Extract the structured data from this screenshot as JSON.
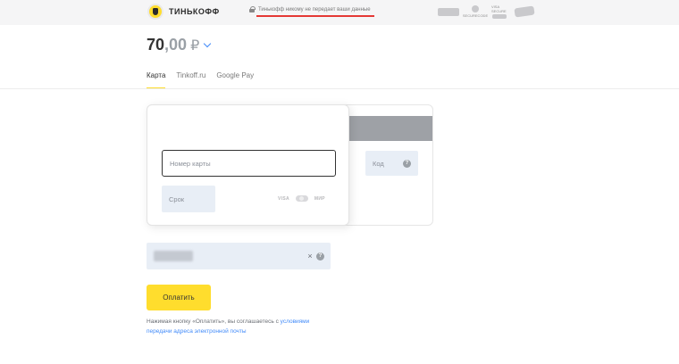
{
  "header": {
    "brand": "ТИНЬКОФФ",
    "security_note": "Тинькофф никому не передает ваши данные",
    "security_logos": [
      {
        "name": "pci-dss",
        "text": ""
      },
      {
        "name": "mastercard-securecode",
        "text": "SECURECODE"
      },
      {
        "name": "verified-by-visa",
        "text": "VISA SECURE"
      },
      {
        "name": "mir-accept",
        "text": "МИР"
      }
    ]
  },
  "amount": {
    "integer": "70",
    "fraction": ",00",
    "currency": "₽"
  },
  "tabs": [
    {
      "label": "Карта",
      "active": true
    },
    {
      "label": "Tinkoff.ru",
      "active": false
    },
    {
      "label": "Google Pay",
      "active": false
    }
  ],
  "card_form": {
    "number_placeholder": "Номер карты",
    "expiry_placeholder": "Срок",
    "cvc_label": "Код",
    "help_symbol": "?",
    "payment_systems": [
      "VISA",
      "МИР"
    ]
  },
  "email": {
    "value": "",
    "clear_symbol": "×",
    "help_symbol": "?"
  },
  "pay_button_label": "Оплатить",
  "terms": {
    "prefix": "Нажимая кнопку «Оплатить», вы соглашаетесь с ",
    "link": "условиями передачи адреса электронной почты"
  },
  "colors": {
    "accent": "#ffdd2d",
    "link": "#428bf9",
    "field_bg": "#e8eef6",
    "underline": "#e53935"
  }
}
